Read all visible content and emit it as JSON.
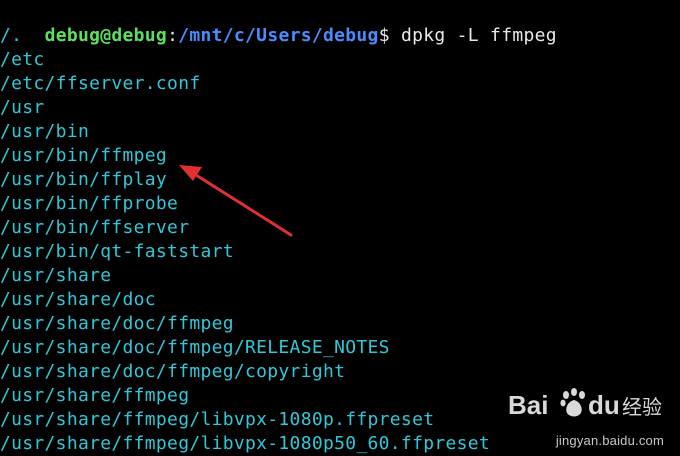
{
  "prompt": {
    "user_host": "debug@debug",
    "separator": ":",
    "path": "/mnt/c/Users/debug",
    "symbol": "$",
    "command": " dpkg -L ffmpeg"
  },
  "output_lines": [
    "/.",
    "/etc",
    "/etc/ffserver.conf",
    "/usr",
    "/usr/bin",
    "/usr/bin/ffmpeg",
    "/usr/bin/ffplay",
    "/usr/bin/ffprobe",
    "/usr/bin/ffserver",
    "/usr/bin/qt-faststart",
    "/usr/share",
    "/usr/share/doc",
    "/usr/share/doc/ffmpeg",
    "/usr/share/doc/ffmpeg/RELEASE_NOTES",
    "/usr/share/doc/ffmpeg/copyright",
    "/usr/share/ffmpeg",
    "/usr/share/ffmpeg/libvpx-1080p.ffpreset",
    "/usr/share/ffmpeg/libvpx-1080p50_60.ffpreset"
  ],
  "annotation": {
    "arrow_color": "#e03030",
    "arrow_target_line": "/usr/bin/ffmpeg"
  },
  "watermark": {
    "brand": "Bai du 经验",
    "url": "jingyan.baidu.com"
  },
  "colors": {
    "background": "#000000",
    "output_text": "#30c8d8",
    "user_host": "#5ee05e",
    "path": "#4a8cff",
    "command": "#e8e8e8"
  }
}
